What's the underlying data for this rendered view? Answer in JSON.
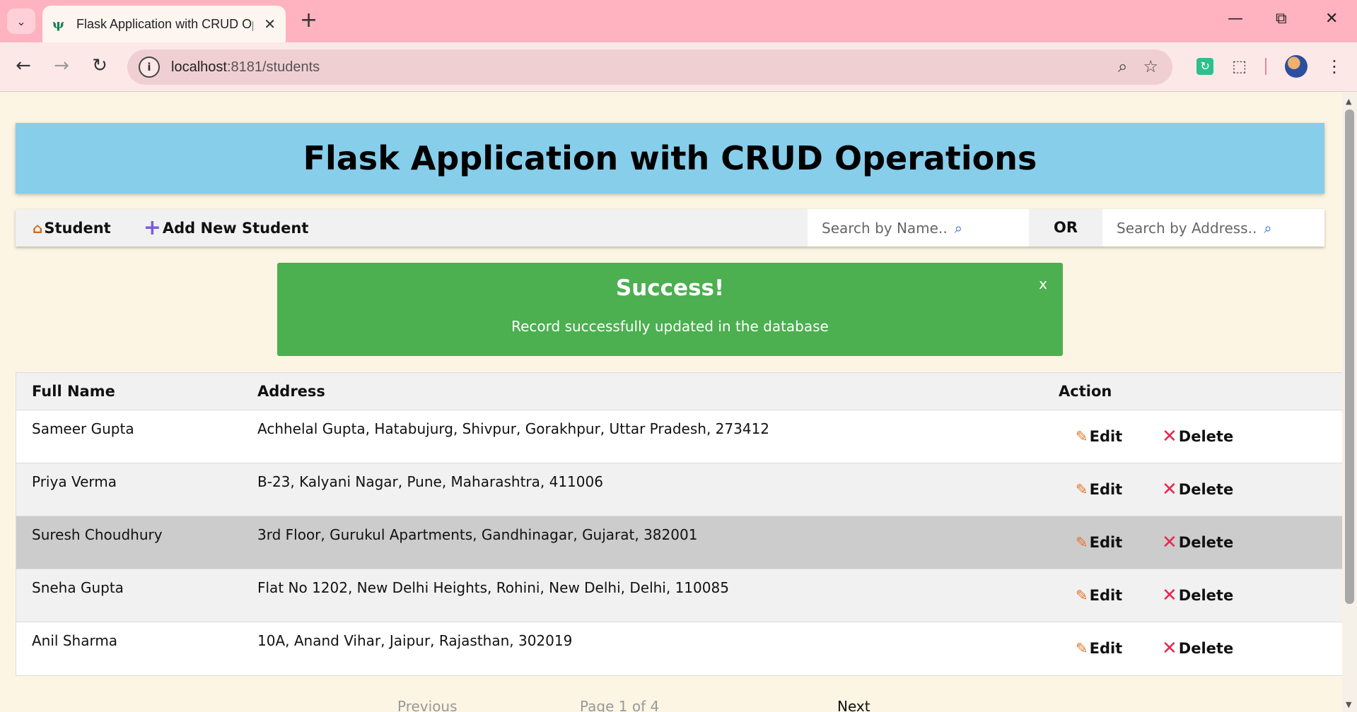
{
  "browser": {
    "tab_title": "Flask Application with CRUD Operations",
    "url_host": "localhost",
    "url_path": ":8181/students"
  },
  "page": {
    "header_title": "Flask Application with CRUD Operations",
    "menu": {
      "home_label": "Student",
      "add_label": "Add New Student",
      "search_name_placeholder": "Search by Name..",
      "or_label": "OR",
      "search_address_placeholder": "Search by Address.."
    },
    "alert": {
      "title": "Success!",
      "message": "Record successfully updated in the database",
      "close": "x",
      "color": "#4caf50"
    },
    "table": {
      "headers": {
        "name": "Full Name",
        "address": "Address",
        "action": "Action"
      },
      "edit_label": "Edit",
      "delete_label": "Delete",
      "rows": [
        {
          "name": "Sameer Gupta",
          "address": "Achhelal Gupta, Hatabujurg, Shivpur, Gorakhpur, Uttar Pradesh, 273412"
        },
        {
          "name": "Priya Verma",
          "address": "B-23, Kalyani Nagar, Pune, Maharashtra, 411006"
        },
        {
          "name": "Suresh Choudhury",
          "address": "3rd Floor, Gurukul Apartments, Gandhinagar, Gujarat, 382001"
        },
        {
          "name": "Sneha Gupta",
          "address": "Flat No 1202, New Delhi Heights, Rohini, New Delhi, Delhi, 110085"
        },
        {
          "name": "Anil Sharma",
          "address": "10A, Anand Vihar, Jaipur, Rajasthan, 302019"
        }
      ]
    },
    "pagination": {
      "previous": "Previous",
      "info": "Page 1 of 4",
      "next": "Next"
    }
  }
}
